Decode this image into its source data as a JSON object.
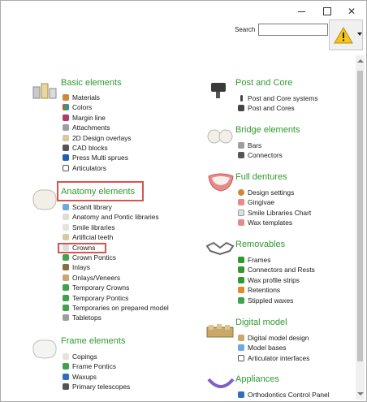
{
  "titlebar": {
    "minimize": "–",
    "maximize": "□",
    "close": "✕"
  },
  "search": {
    "label": "Search",
    "value": ""
  },
  "warning_icon": "warning-triangle-icon",
  "sections": {
    "basic": {
      "title": "Basic elements",
      "items": [
        "Materials",
        "Colors",
        "Margin line",
        "Attachments",
        "2D Design overlays",
        "CAD blocks",
        "Press Multi sprues",
        "Articulators"
      ]
    },
    "anatomy": {
      "title": "Anatomy elements",
      "items": [
        "ScanIt library",
        "Anatomy and Pontic libraries",
        "Smile libraries",
        "Artificial teeth",
        "Crowns",
        "Crown Pontics",
        "Inlays",
        "Onlays/Veneers",
        "Temporary Crowns",
        "Temporary Pontics",
        "Temporaries on prepared model",
        "Tabletops"
      ]
    },
    "frame": {
      "title": "Frame elements",
      "items": [
        "Copings",
        "Frame Pontics",
        "Waxups",
        "Primary telescopes"
      ]
    },
    "post": {
      "title": "Post and Core",
      "items": [
        "Post and Core systems",
        "Post and Cores"
      ]
    },
    "bridge": {
      "title": "Bridge elements",
      "items": [
        "Bars",
        "Connectors"
      ]
    },
    "dentures": {
      "title": "Full dentures",
      "items": [
        "Design settings",
        "Gingivae",
        "Smile Libraries Chart",
        "Wax templates"
      ]
    },
    "removables": {
      "title": "Removables",
      "items": [
        "Frames",
        "Connectors and Rests",
        "Wax profile strips",
        "Retentions",
        "Stippled waxes"
      ]
    },
    "digital": {
      "title": "Digital model",
      "items": [
        "Digital model design",
        "Model bases",
        "Articulator interfaces"
      ]
    },
    "appliances": {
      "title": "Appliances",
      "items": [
        "Orthodontics Control Panel"
      ]
    }
  },
  "colors": {
    "title_green": "#2f9a2f",
    "highlight_red": "#d9534f"
  }
}
